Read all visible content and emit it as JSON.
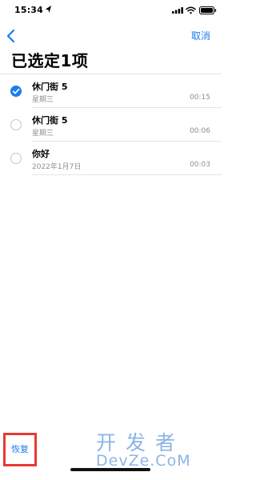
{
  "status_bar": {
    "time": "15:34"
  },
  "nav": {
    "cancel_label": "取消"
  },
  "page_title": "已选定1项",
  "recordings": [
    {
      "title": "休门街 5",
      "subtitle": "星期三",
      "duration": "00:15",
      "selected": true
    },
    {
      "title": "休门街 5",
      "subtitle": "星期三",
      "duration": "00:06",
      "selected": false
    },
    {
      "title": "你好",
      "subtitle": "2022年1月7日",
      "duration": "00:03",
      "selected": false
    }
  ],
  "toolbar": {
    "restore_label": "恢复"
  },
  "watermark": {
    "chinese": "开发者",
    "latin": "DevZe.CoM"
  },
  "colors": {
    "accent": "#1a7cf0",
    "highlight_box": "#e53935",
    "secondary_text": "#8e8e93"
  }
}
